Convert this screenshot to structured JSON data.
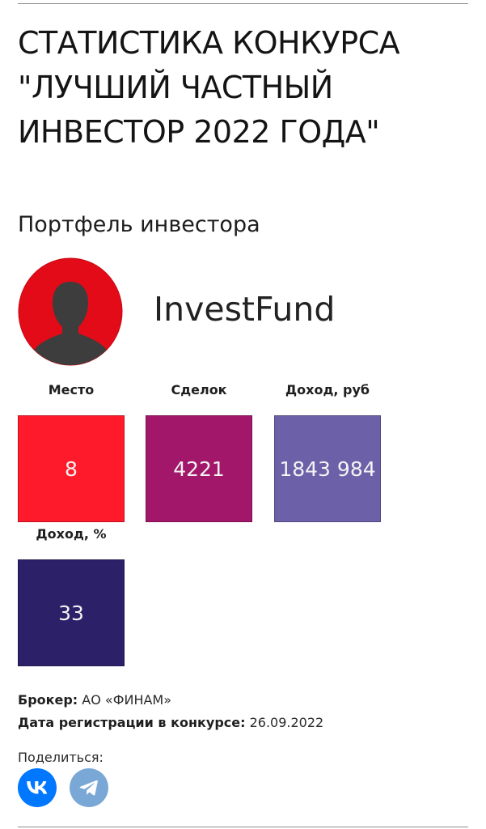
{
  "page": {
    "title_lines": [
      "СТАТИСТИКА КОНКУРСА",
      "\"ЛУЧШИЙ ЧАСТНЫЙ",
      "ИНВЕСТОР 2022 ГОДА\""
    ],
    "section_title": "Портфель инвестора"
  },
  "investor": {
    "name": "InvestFund",
    "avatar_icon": "user-silhouette-icon",
    "avatar_color": "#e30b17"
  },
  "stats": [
    {
      "label": "Место",
      "value": "8",
      "color": "#ff1a2b"
    },
    {
      "label": "Сделок",
      "value": "4221",
      "color": "#a3176a"
    },
    {
      "label": "Доход, руб",
      "value": "1843 984",
      "color": "#6c60a8"
    },
    {
      "label": "Доход, %",
      "value": "33",
      "color": "#2c2068"
    }
  ],
  "info": {
    "broker_label": "Брокер:",
    "broker_value": "АО «ФИНАМ»",
    "date_label": "Дата регистрации в конкурсе:",
    "date_value": "26.09.2022"
  },
  "share": {
    "label": "Поделиться:",
    "buttons": [
      {
        "icon": "vk-icon",
        "color": "#0077ff"
      },
      {
        "icon": "telegram-icon",
        "color": "#7aa8d6"
      }
    ]
  }
}
